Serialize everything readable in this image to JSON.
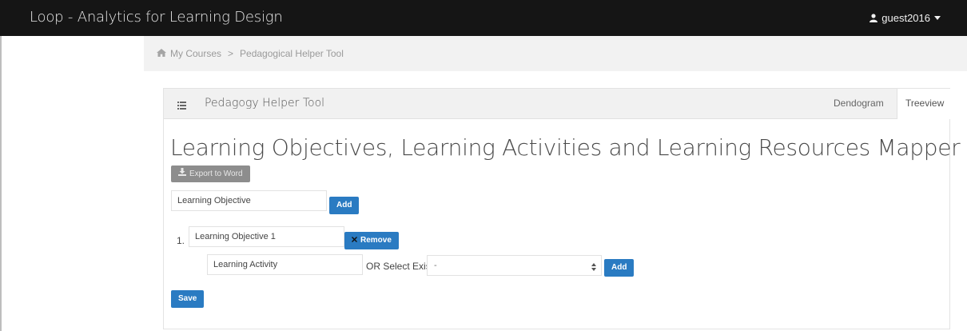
{
  "app": {
    "title": "Loop - Analytics for Learning Design",
    "user": "guest2016"
  },
  "breadcrumb": {
    "home": "My Courses",
    "separator": ">",
    "current": "Pedagogical Helper Tool"
  },
  "panel": {
    "title": "Pedagogy Helper Tool",
    "tabs": [
      {
        "label": "Dendogram"
      },
      {
        "label": "Treeview"
      }
    ]
  },
  "main": {
    "heading": "Learning Objectives, Learning Activities and Learning Resources Mapper",
    "export_label": "Export to Word",
    "objective_input": {
      "value": "Learning Objective"
    },
    "add_label": "Add",
    "objectives": [
      {
        "index": "1.",
        "value": "Learning Objective 1",
        "remove_label": "Remove"
      }
    ],
    "activity_input": {
      "value": "Learning Activity"
    },
    "or_select_label": "OR Select Existing",
    "select_value": "-",
    "save_label": "Save"
  },
  "colors": {
    "navbar": "#151515",
    "primary_button": "#2a7bc2",
    "export_button": "#8d8d8d"
  }
}
